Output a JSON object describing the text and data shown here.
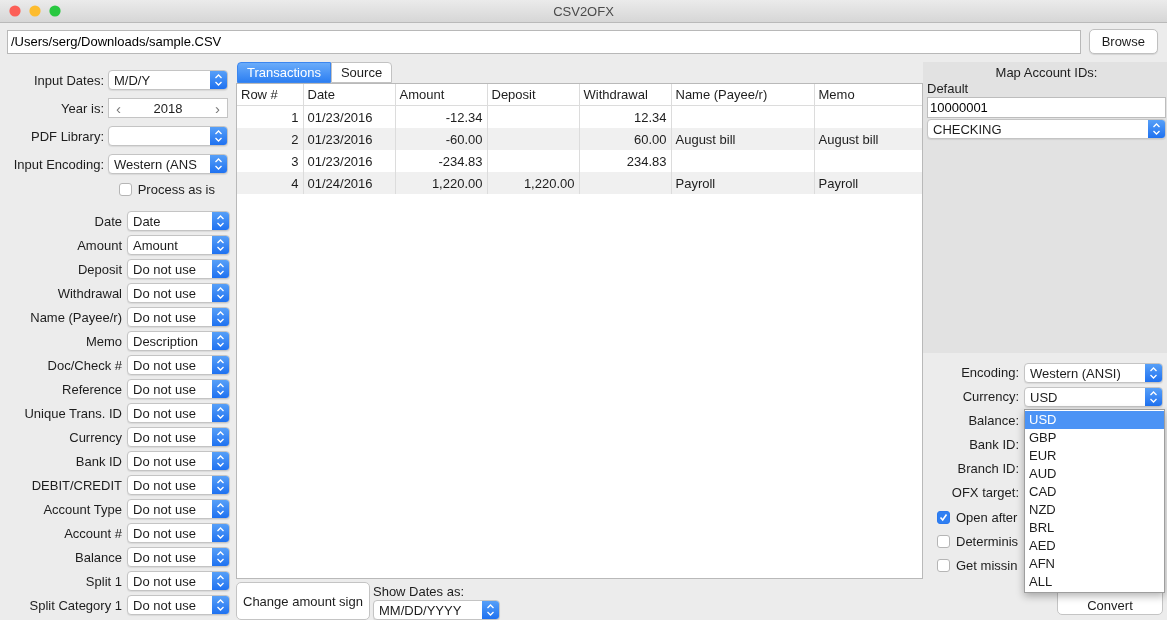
{
  "window": {
    "title": "CSV2OFX"
  },
  "path_bar": {
    "path": "/Users/serg/Downloads/sample.CSV",
    "browse": "Browse"
  },
  "input_settings": {
    "input_dates": {
      "label": "Input Dates:",
      "value": "M/D/Y"
    },
    "year": {
      "label": "Year is:",
      "prev": "‹",
      "value": "2018",
      "next": "›"
    },
    "pdf_library": {
      "label": "PDF Library:"
    },
    "input_encoding": {
      "label": "Input Encoding:",
      "value": "Western (ANS"
    },
    "process_as_is": {
      "label": "Process as is",
      "checked": false
    }
  },
  "field_mappings": [
    {
      "label": "Date",
      "value": "Date"
    },
    {
      "label": "Amount",
      "value": "Amount"
    },
    {
      "label": "Deposit",
      "value": "Do not use"
    },
    {
      "label": "Withdrawal",
      "value": "Do not use"
    },
    {
      "label": "Name (Payee/r)",
      "value": "Do not use"
    },
    {
      "label": "Memo",
      "value": "Description"
    },
    {
      "label": "Doc/Check #",
      "value": "Do not use"
    },
    {
      "label": "Reference",
      "value": "Do not use"
    },
    {
      "label": "Unique Trans. ID",
      "value": "Do not use"
    },
    {
      "label": "Currency",
      "value": "Do not use"
    },
    {
      "label": "Bank ID",
      "value": "Do not use"
    },
    {
      "label": "DEBIT/CREDIT",
      "value": "Do not use"
    },
    {
      "label": "Account Type",
      "value": "Do not use"
    },
    {
      "label": "Account #",
      "value": "Do not use"
    },
    {
      "label": "Balance",
      "value": "Do not use"
    },
    {
      "label": "Split 1",
      "value": "Do not use"
    },
    {
      "label": "Split Category 1",
      "value": "Do not use"
    }
  ],
  "tabs": [
    {
      "label": "Transactions",
      "selected": true
    },
    {
      "label": "Source",
      "selected": false
    }
  ],
  "table": {
    "columns": [
      "Row #",
      "Date",
      "Amount",
      "Deposit",
      "Withdrawal",
      "Name (Payee/r)",
      "Memo"
    ],
    "rows": [
      [
        "1",
        "01/23/2016",
        "-12.34",
        "",
        "12.34",
        "",
        ""
      ],
      [
        "2",
        "01/23/2016",
        "-60.00",
        "",
        "60.00",
        "August bill",
        "August bill"
      ],
      [
        "3",
        "01/23/2016",
        "-234.83",
        "",
        "234.83",
        "",
        ""
      ],
      [
        "4",
        "01/24/2016",
        "1,220.00",
        "1,220.00",
        "",
        "Payroll",
        "Payroll"
      ]
    ]
  },
  "bottom_bar": {
    "change_sign": "Change amount sign",
    "show_dates_label": "Show Dates as:",
    "show_dates_value": "MM/DD/YYYY"
  },
  "account_map": {
    "title": "Map Account IDs:",
    "default_label": "Default",
    "account_id": "10000001",
    "account_type": "CHECKING"
  },
  "output_settings": {
    "encoding": {
      "label": "Encoding:",
      "value": "Western (ANSI)"
    },
    "currency": {
      "label": "Currency:",
      "value": "USD",
      "open": true,
      "options": [
        {
          "label": "USD",
          "selected": true
        },
        {
          "label": "GBP",
          "selected": false
        },
        {
          "label": "EUR",
          "selected": false
        },
        {
          "label": "AUD",
          "selected": false
        },
        {
          "label": "CAD",
          "selected": false
        },
        {
          "label": "NZD",
          "selected": false
        },
        {
          "label": "BRL",
          "selected": false
        },
        {
          "label": "AED",
          "selected": false
        },
        {
          "label": "AFN",
          "selected": false
        },
        {
          "label": "ALL",
          "selected": false
        }
      ]
    },
    "labels": [
      "Balance:",
      "Bank ID:",
      "Branch ID:",
      "OFX target:"
    ],
    "checkboxes": [
      {
        "label": "Open after",
        "checked": true
      },
      {
        "label": "Determinis",
        "checked": false
      },
      {
        "label": "Get missin",
        "checked": false
      }
    ],
    "convert": "Convert"
  }
}
